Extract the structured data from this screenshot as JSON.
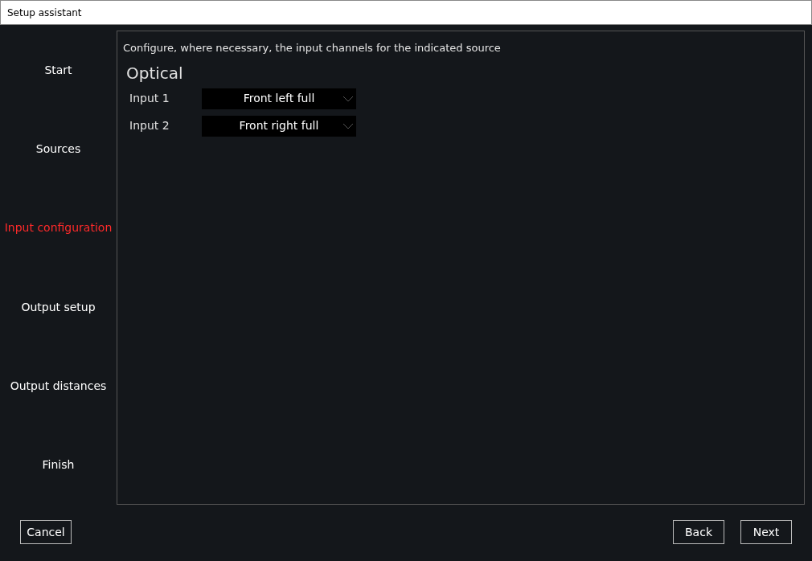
{
  "window": {
    "title": "Setup assistant"
  },
  "steps": [
    {
      "label": "Start",
      "selected": false
    },
    {
      "label": "Sources",
      "selected": false
    },
    {
      "label": "Input configuration",
      "selected": true
    },
    {
      "label": "Output setup",
      "selected": false
    },
    {
      "label": "Output distances",
      "selected": false
    },
    {
      "label": "Finish",
      "selected": false
    }
  ],
  "panel": {
    "instruction": "Configure, where necessary, the input channels for the indicated source",
    "source": "Optical",
    "inputs": [
      {
        "label": "Input 1",
        "value": "Front left full"
      },
      {
        "label": "Input 2",
        "value": "Front right full"
      }
    ]
  },
  "buttons": {
    "cancel": "Cancel",
    "back": "Back",
    "next": "Next"
  }
}
